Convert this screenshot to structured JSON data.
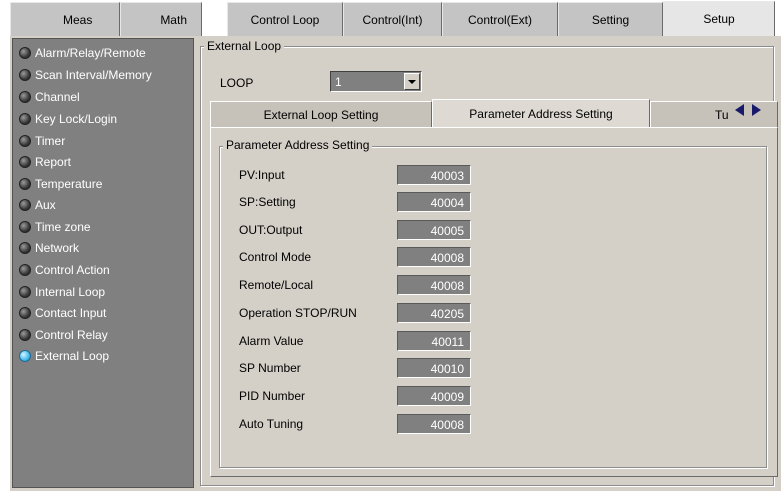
{
  "top_tabs": [
    "Meas",
    "Math",
    "Control Loop",
    "Control(Int)",
    "Control(Ext)",
    "Setting",
    "Setup"
  ],
  "active_top_tab": "Setup",
  "sidebar": {
    "items": [
      {
        "label": "Alarm/Relay/Remote"
      },
      {
        "label": "Scan Interval/Memory"
      },
      {
        "label": "Channel"
      },
      {
        "label": "Key Lock/Login"
      },
      {
        "label": "Timer"
      },
      {
        "label": "Report"
      },
      {
        "label": "Temperature"
      },
      {
        "label": "Aux"
      },
      {
        "label": "Time zone"
      },
      {
        "label": "Network"
      },
      {
        "label": "Control Action"
      },
      {
        "label": "Internal Loop"
      },
      {
        "label": "Contact Input"
      },
      {
        "label": "Control Relay"
      },
      {
        "label": "External Loop"
      }
    ],
    "selected": "External Loop"
  },
  "main": {
    "group_title": "External Loop",
    "loop_label": "LOOP",
    "loop_value": "1",
    "sub_tabs": [
      "External Loop Setting",
      "Parameter Address Setting",
      "Tu"
    ],
    "active_sub_tab": "Parameter Address Setting",
    "panel_title": "Parameter Address Setting",
    "params": [
      {
        "label": "PV:Input",
        "value": "40003"
      },
      {
        "label": "SP:Setting",
        "value": "40004"
      },
      {
        "label": "OUT:Output",
        "value": "40005"
      },
      {
        "label": "Control Mode",
        "value": "40008"
      },
      {
        "label": "Remote/Local",
        "value": "40008"
      },
      {
        "label": "Operation STOP/RUN",
        "value": "40205"
      },
      {
        "label": "Alarm Value",
        "value": "40011"
      },
      {
        "label": "SP Number",
        "value": "40010"
      },
      {
        "label": "PID Number",
        "value": "40009"
      },
      {
        "label": "Auto Tuning",
        "value": "40008"
      }
    ]
  },
  "colors": {
    "sidebar_bg": "#808080",
    "selected_bullet": "#4ec0f0",
    "field_bg": "#808080",
    "panel_bg": "#d4d0c8"
  }
}
